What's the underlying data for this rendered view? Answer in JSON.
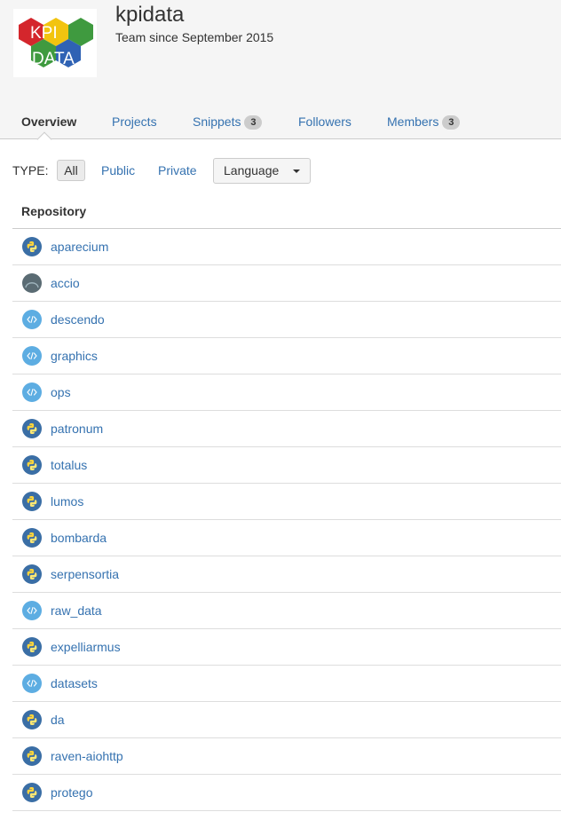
{
  "team": {
    "name": "kpidata",
    "since": "Team since September 2015",
    "logo_text_top": "KPI",
    "logo_text_bottom": "DATA"
  },
  "tabs": [
    {
      "label": "Overview",
      "active": true
    },
    {
      "label": "Projects"
    },
    {
      "label": "Snippets",
      "badge": "3"
    },
    {
      "label": "Followers"
    },
    {
      "label": "Members",
      "badge": "3"
    }
  ],
  "filter": {
    "type_label": "TYPE:",
    "all": "All",
    "public": "Public",
    "private": "Private",
    "language": "Language"
  },
  "repos_header": "Repository",
  "repositories": [
    {
      "name": "aparecium",
      "icon": "python-icon"
    },
    {
      "name": "accio",
      "icon": "avatar-icon"
    },
    {
      "name": "descendo",
      "icon": "code-icon"
    },
    {
      "name": "graphics",
      "icon": "code-icon"
    },
    {
      "name": "ops",
      "icon": "code-icon"
    },
    {
      "name": "patronum",
      "icon": "python-icon"
    },
    {
      "name": "totalus",
      "icon": "python-icon"
    },
    {
      "name": "lumos",
      "icon": "python-icon"
    },
    {
      "name": "bombarda",
      "icon": "python-icon"
    },
    {
      "name": "serpensortia",
      "icon": "python-icon"
    },
    {
      "name": "raw_data",
      "icon": "code-icon"
    },
    {
      "name": "expelliarmus",
      "icon": "python-icon"
    },
    {
      "name": "datasets",
      "icon": "code-icon"
    },
    {
      "name": "da",
      "icon": "python-icon"
    },
    {
      "name": "raven-aiohttp",
      "icon": "python-icon"
    },
    {
      "name": "protego",
      "icon": "python-icon"
    }
  ],
  "colors": {
    "link": "#3572b0",
    "python_bg": "#3a6ea5",
    "code_bg": "#5dade2",
    "avatar_bg": "#5a6b73"
  }
}
